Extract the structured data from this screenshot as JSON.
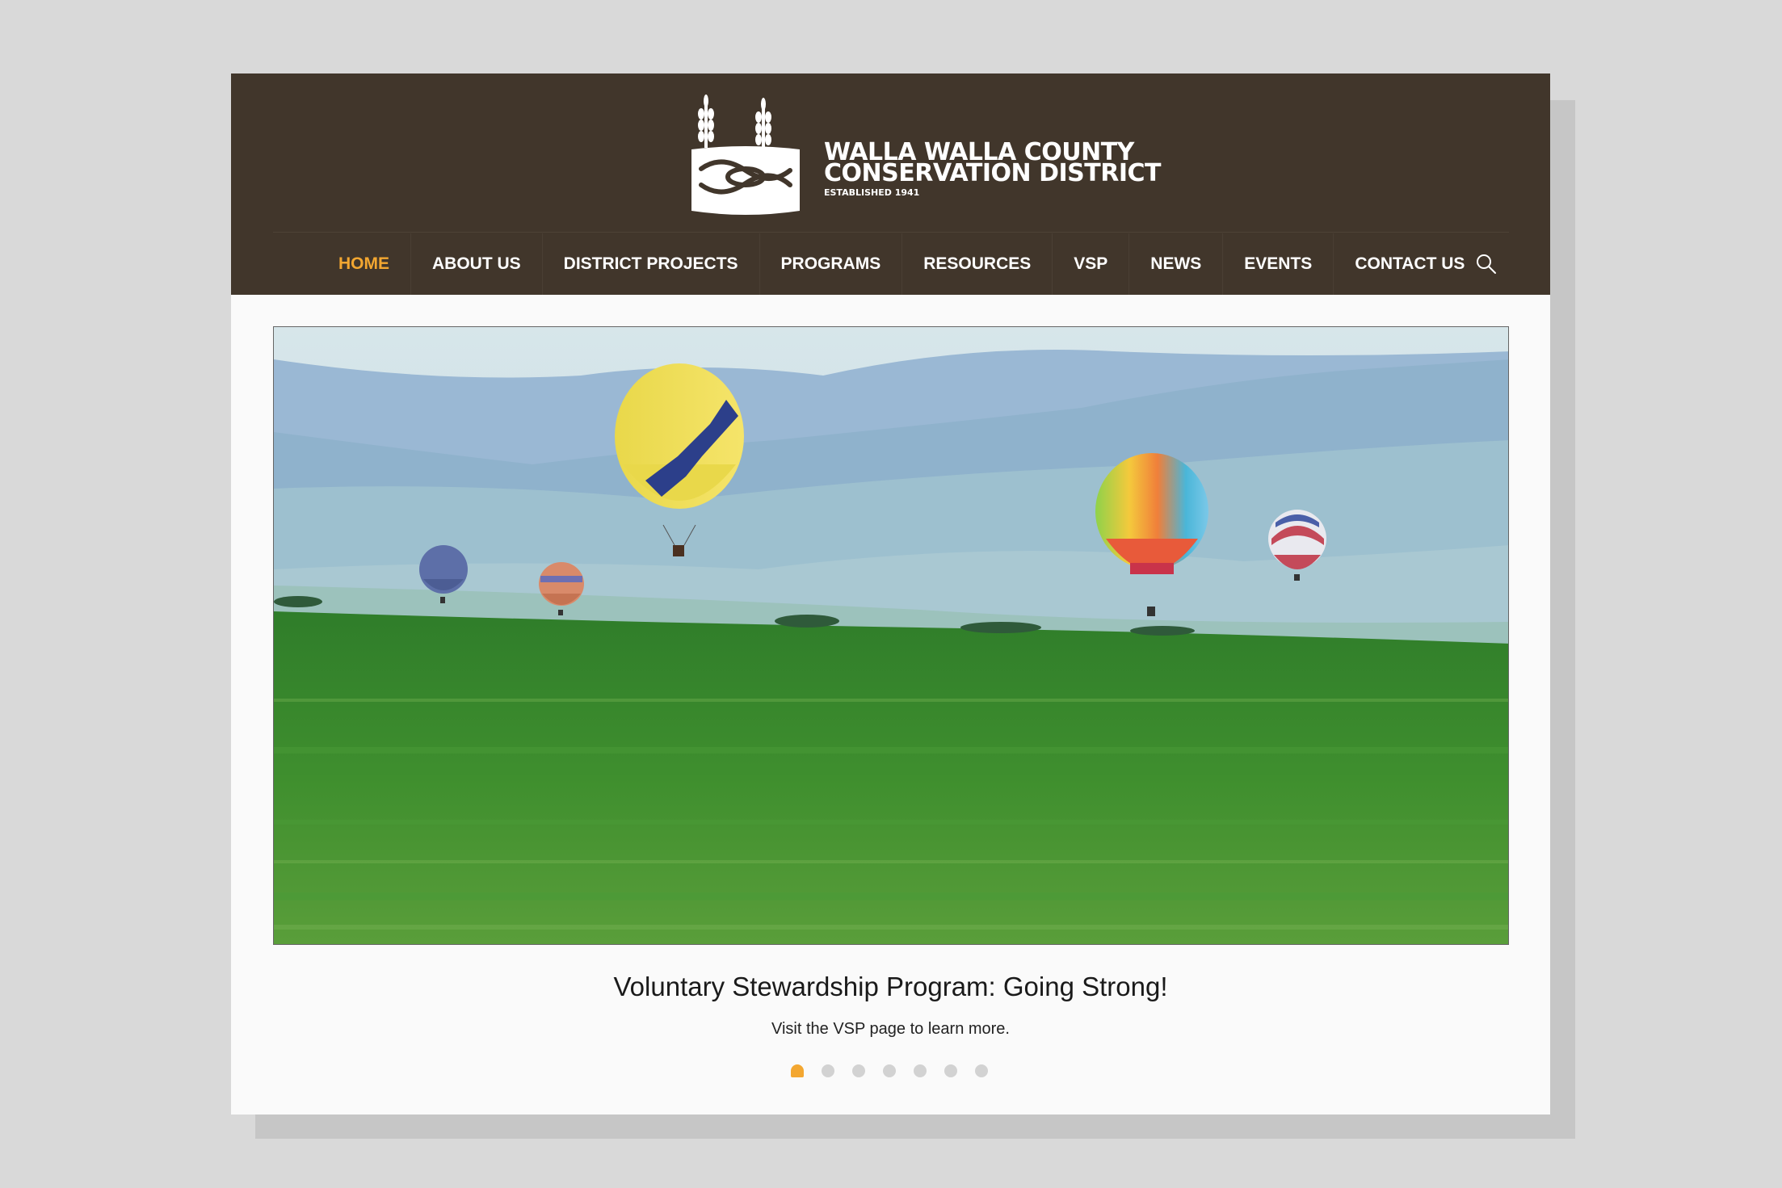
{
  "logo": {
    "line1": "WALLA WALLA COUNTY",
    "line2": "CONSERVATION DISTRICT",
    "line3": "ESTABLISHED 1941"
  },
  "nav": {
    "items": [
      {
        "label": "HOME",
        "active": true
      },
      {
        "label": "ABOUT US"
      },
      {
        "label": "DISTRICT PROJECTS"
      },
      {
        "label": "PROGRAMS"
      },
      {
        "label": "RESOURCES"
      },
      {
        "label": "VSP"
      },
      {
        "label": "NEWS"
      },
      {
        "label": "EVENTS"
      },
      {
        "label": "CONTACT US"
      }
    ],
    "search_icon": "search-icon"
  },
  "slider": {
    "image": "hot-air-balloons-over-green-field",
    "caption_title": "Voluntary Stewardship Program: Going Strong!",
    "caption_text": "Visit the VSP page to learn more.",
    "slide_count": 7,
    "active_slide": 1
  },
  "colors": {
    "header_bg": "#41362b",
    "accent": "#f3a731",
    "page_bg": "#fafafa",
    "backdrop": "#d9d9d9"
  }
}
